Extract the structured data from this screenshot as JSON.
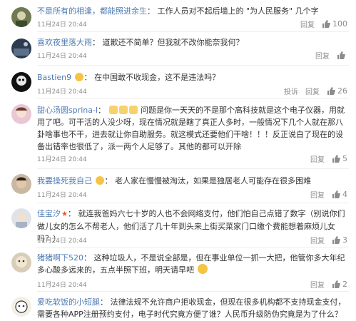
{
  "actions": {
    "reply": "回复",
    "report": "投诉"
  },
  "comments": [
    {
      "user": "不是所有的相逢，都能照进余生",
      "text": "工作人员对不起后墙上的 \"为人民服务\" 几个字",
      "time": "11月24日 20:44",
      "likes": "100"
    },
    {
      "user": "喜欢夜里落大雨",
      "text": "道歉还不简单？但我就不改你能奈我何？",
      "time": "11月24日 20:44",
      "likes": ""
    },
    {
      "user": "Bastien9",
      "text": "在中国敢不收现金，这不是违法吗？",
      "time": "11月24日 20:44",
      "likes": "26"
    },
    {
      "user": "甜心汤圆sprina-l",
      "text_line1": "问题是你一天天的不是那个高科技就是这个电子仪器，用就用了吧。可干活的人没少呀，现在情况就是瞎了真正人多时，一般情况下几个人就在那八卦啥事也不干，进去就让你自助服务。就这模式还要他们干啥！！！反正说白了现在的设备出错率也很低了，派一两个人足够了。其他的都可以开除",
      "time": "11月24日 20:44",
      "likes": "5"
    },
    {
      "user": "我要操死我自己",
      "text": "老人家在慢慢被淘汰，如果是独居老人可能存在很多困难",
      "time": "11月24日 20:44",
      "likes": "4"
    },
    {
      "user": "佳宝汐",
      "text": "就连我爸妈六七十岁的人也不会网络支付，他们怕自己点错了数字（别说你们做儿女的怎么不帮老人，他们活了几十年到头来上街买菜家门口缴个费能想着麻烦儿女吗？）",
      "time": "11月24日 20:44",
      "likes": "3"
    },
    {
      "user": "猪猪啊下520",
      "text": "这种垃圾人，不是说全部是，但在事业单位一抓一大把，他管你多大年纪多心酸多远来的，五点半照下班，明天请早吧",
      "time": "11月24日 20:44",
      "likes": "2"
    },
    {
      "user": "爱吃软饭的小短腿",
      "text": "法律法规不允许商户拒收现金，但现在很多机构都不支持现金支付，需要各种APP注册预约支付，电子时代究竟方便了谁？人民币升级防伪究竟是为了什么？",
      "time": "",
      "likes": ""
    }
  ]
}
